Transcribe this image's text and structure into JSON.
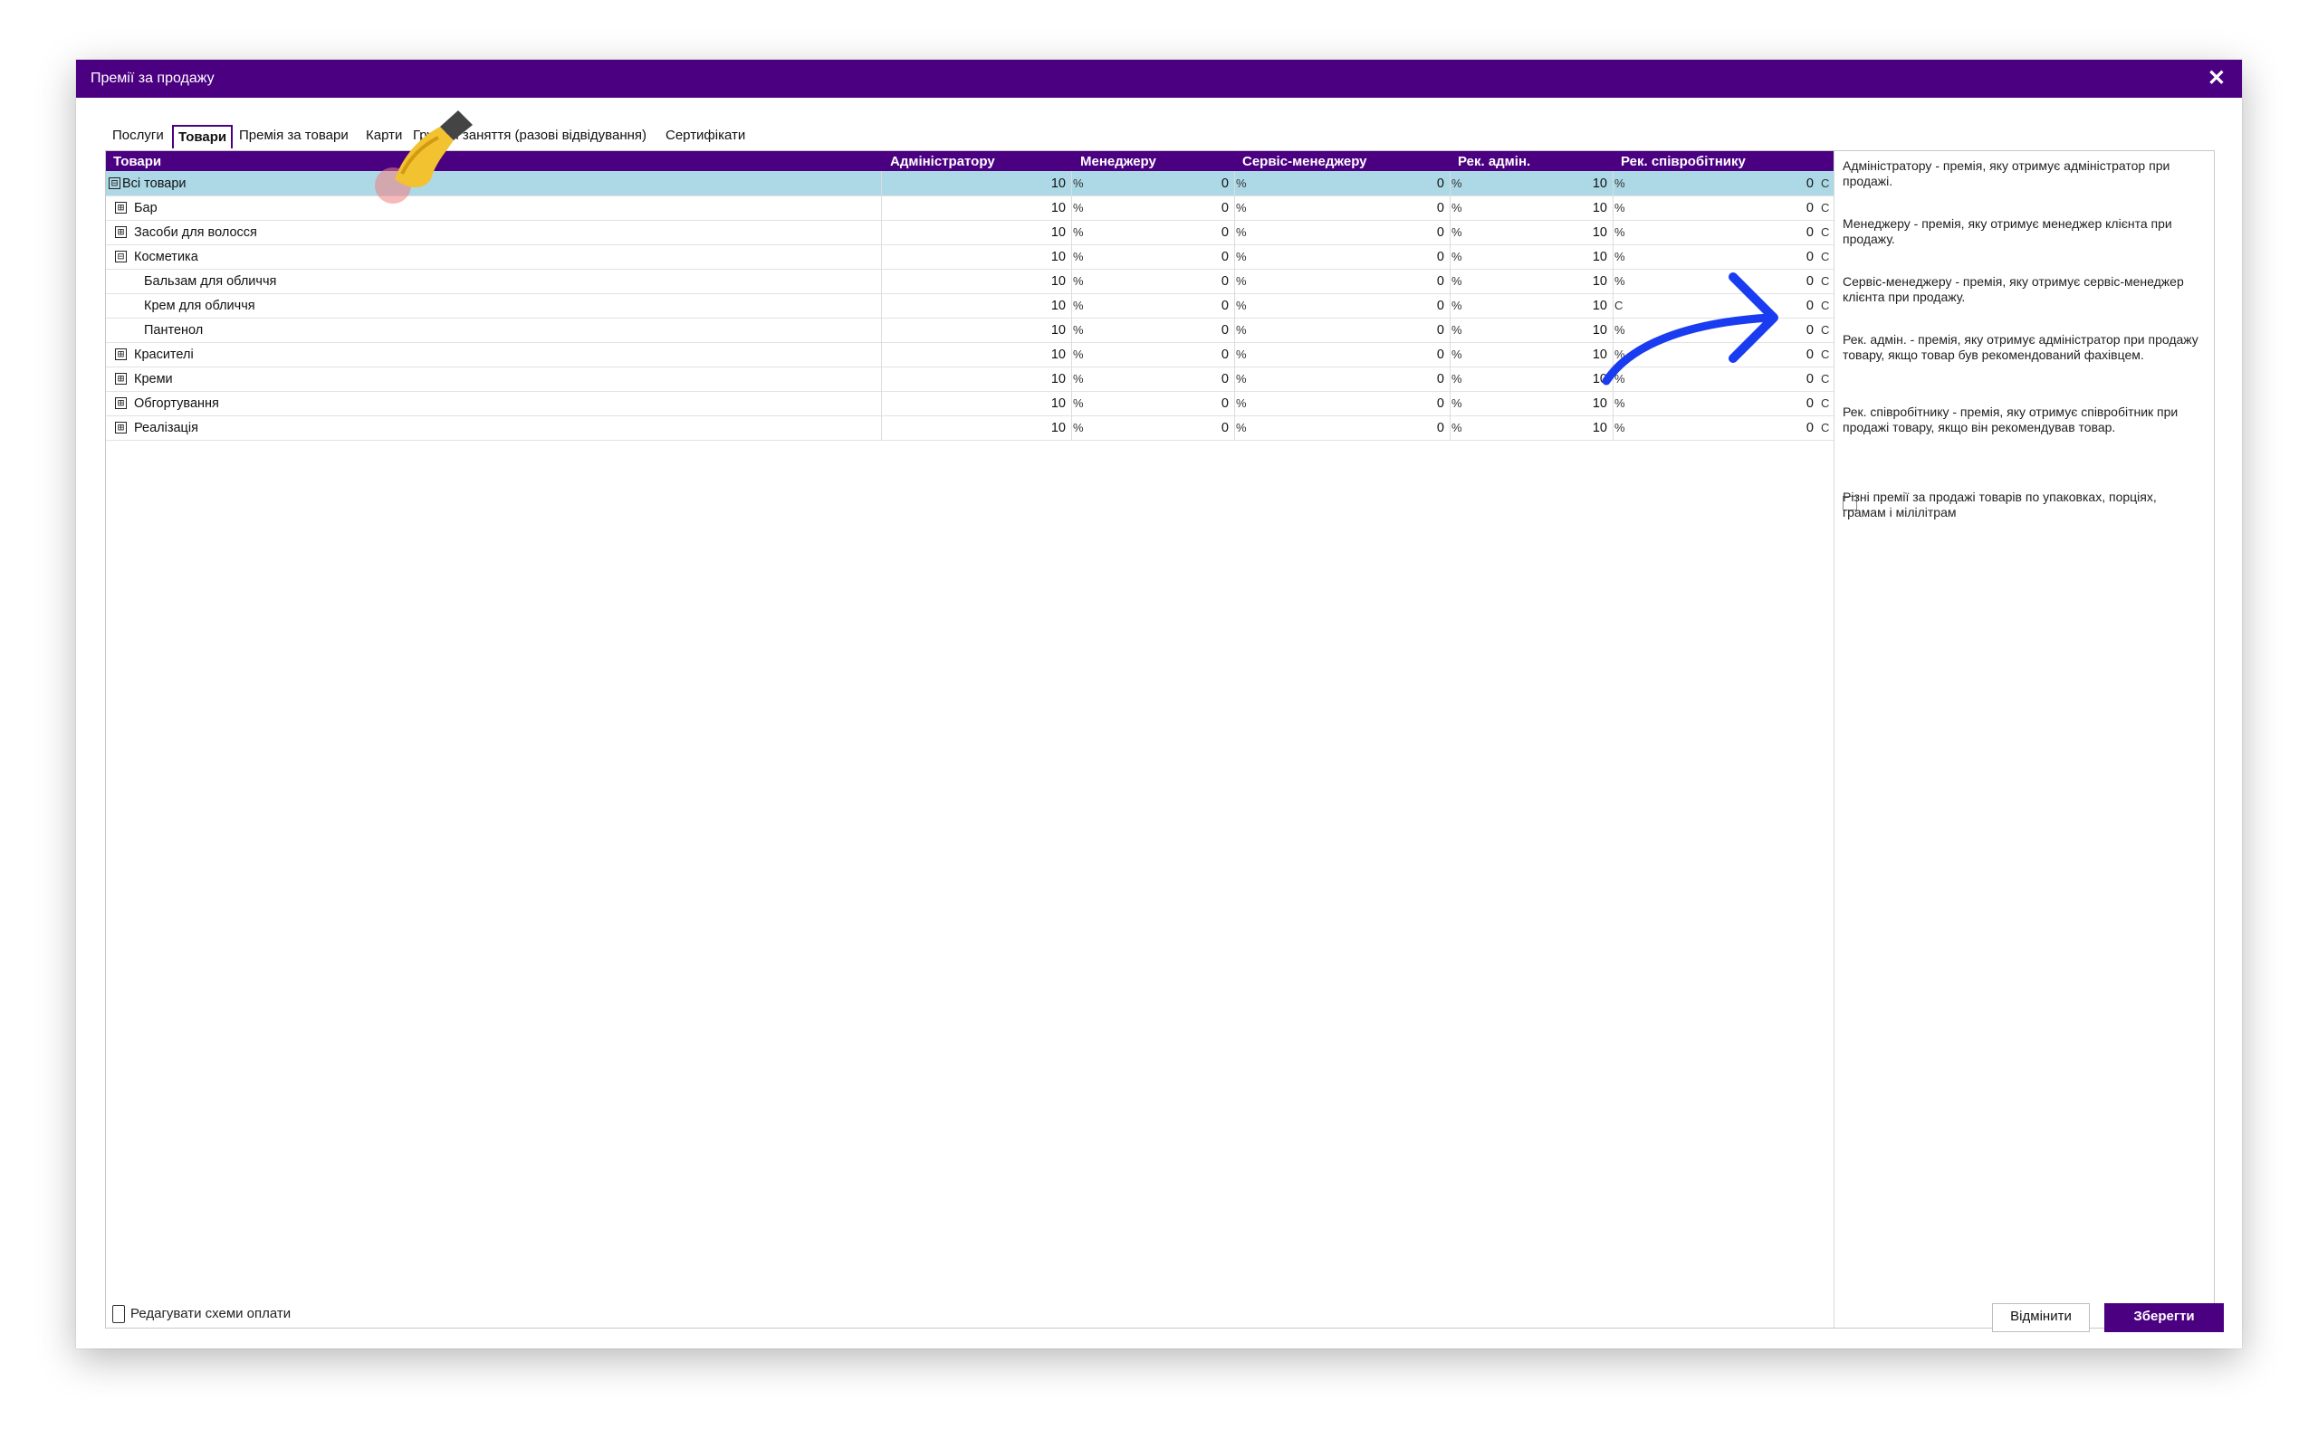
{
  "window": {
    "title": "Премії за продажу"
  },
  "tabs": [
    {
      "label": "Послуги"
    },
    {
      "label": "Товари"
    },
    {
      "label": "Премія за товари"
    },
    {
      "label": "Карти"
    },
    {
      "label": "Групові заняття (разові відвідування)"
    },
    {
      "label": "Сертифікати"
    }
  ],
  "columns": {
    "name": "Товари",
    "admin": "Адміністратору",
    "manager": "Менеджеру",
    "service": "Сервіс-менеджеру",
    "rec_admin": "Рек. адмін.",
    "rec_employee": "Рек. співробітнику"
  },
  "rows": [
    {
      "name": "Всі товари",
      "expander": "⊟",
      "admin": "10",
      "admin_unit": "%",
      "manager": "0",
      "manager_unit": "%",
      "service": "0",
      "service_unit": "%",
      "rec_admin": "10",
      "rec_admin_unit": "%",
      "rec_employee": "0",
      "rec_employee_unit": "С"
    },
    {
      "name": "Бар",
      "expander": "⊞",
      "admin": "10",
      "admin_unit": "%",
      "manager": "0",
      "manager_unit": "%",
      "service": "0",
      "service_unit": "%",
      "rec_admin": "10",
      "rec_admin_unit": "%",
      "rec_employee": "0",
      "rec_employee_unit": "С"
    },
    {
      "name": "Засоби для волосся",
      "expander": "⊞",
      "admin": "10",
      "admin_unit": "%",
      "manager": "0",
      "manager_unit": "%",
      "service": "0",
      "service_unit": "%",
      "rec_admin": "10",
      "rec_admin_unit": "%",
      "rec_employee": "0",
      "rec_employee_unit": "С"
    },
    {
      "name": "Косметика",
      "expander": "⊟",
      "admin": "10",
      "admin_unit": "%",
      "manager": "0",
      "manager_unit": "%",
      "service": "0",
      "service_unit": "%",
      "rec_admin": "10",
      "rec_admin_unit": "%",
      "rec_employee": "0",
      "rec_employee_unit": "С"
    },
    {
      "name": "Бальзам для обличчя",
      "expander": "",
      "admin": "10",
      "admin_unit": "%",
      "manager": "0",
      "manager_unit": "%",
      "service": "0",
      "service_unit": "%",
      "rec_admin": "10",
      "rec_admin_unit": "%",
      "rec_employee": "0",
      "rec_employee_unit": "С"
    },
    {
      "name": "Крем для обличчя",
      "expander": "",
      "admin": "10",
      "admin_unit": "%",
      "manager": "0",
      "manager_unit": "%",
      "service": "0",
      "service_unit": "%",
      "rec_admin": "10",
      "rec_admin_unit": "С",
      "rec_employee": "0",
      "rec_employee_unit": "С"
    },
    {
      "name": "Пантенол",
      "expander": "",
      "admin": "10",
      "admin_unit": "%",
      "manager": "0",
      "manager_unit": "%",
      "service": "0",
      "service_unit": "%",
      "rec_admin": "10",
      "rec_admin_unit": "%",
      "rec_employee": "0",
      "rec_employee_unit": "С"
    },
    {
      "name": "Красителі",
      "expander": "⊞",
      "admin": "10",
      "admin_unit": "%",
      "manager": "0",
      "manager_unit": "%",
      "service": "0",
      "service_unit": "%",
      "rec_admin": "10",
      "rec_admin_unit": "%",
      "rec_employee": "0",
      "rec_employee_unit": "С"
    },
    {
      "name": "Креми",
      "expander": "⊞",
      "admin": "10",
      "admin_unit": "%",
      "manager": "0",
      "manager_unit": "%",
      "service": "0",
      "service_unit": "%",
      "rec_admin": "10",
      "rec_admin_unit": "%",
      "rec_employee": "0",
      "rec_employee_unit": "С"
    },
    {
      "name": "Обгортування",
      "expander": "⊞",
      "admin": "10",
      "admin_unit": "%",
      "manager": "0",
      "manager_unit": "%",
      "service": "0",
      "service_unit": "%",
      "rec_admin": "10",
      "rec_admin_unit": "%",
      "rec_employee": "0",
      "rec_employee_unit": "С"
    },
    {
      "name": "Реалізація",
      "expander": "⊞",
      "admin": "10",
      "admin_unit": "%",
      "manager": "0",
      "manager_unit": "%",
      "service": "0",
      "service_unit": "%",
      "rec_admin": "10",
      "rec_admin_unit": "%",
      "rec_employee": "0",
      "rec_employee_unit": "С"
    }
  ],
  "side": {
    "desc_admin": "Адміністратору - премія, яку отримує адміністратор при продажі.",
    "desc_manager": "Менеджеру - премія, яку отримує менеджер клієнта при продажу.",
    "desc_service": "Сервіс-менеджеру - премія, яку отримує сервіс-менеджер клієнта при продажу.",
    "desc_rec_admin": "Рек. адмін. - премія, яку отримує адміністратор при продажу товару, якщо товар був рекомендований фахівцем.",
    "desc_rec_employee": "Рек. співробітнику - премія, яку отримує співробітник при продажі товару, якщо він рекомендував товар.",
    "checkbox_label": "Різні премії за продажі товарів по упаковках, порціях, грамам і мілілітрам",
    "checkbox_checked": false
  },
  "footer": {
    "edit_label": "Редагувати схеми оплати",
    "cancel_label": "Відмінити",
    "save_label": "Зберегти"
  },
  "colors": {
    "accent": "#4b0082",
    "selected_row": "#add8e6"
  },
  "icons": {
    "edit": "calculator-icon",
    "close": "close-icon"
  }
}
